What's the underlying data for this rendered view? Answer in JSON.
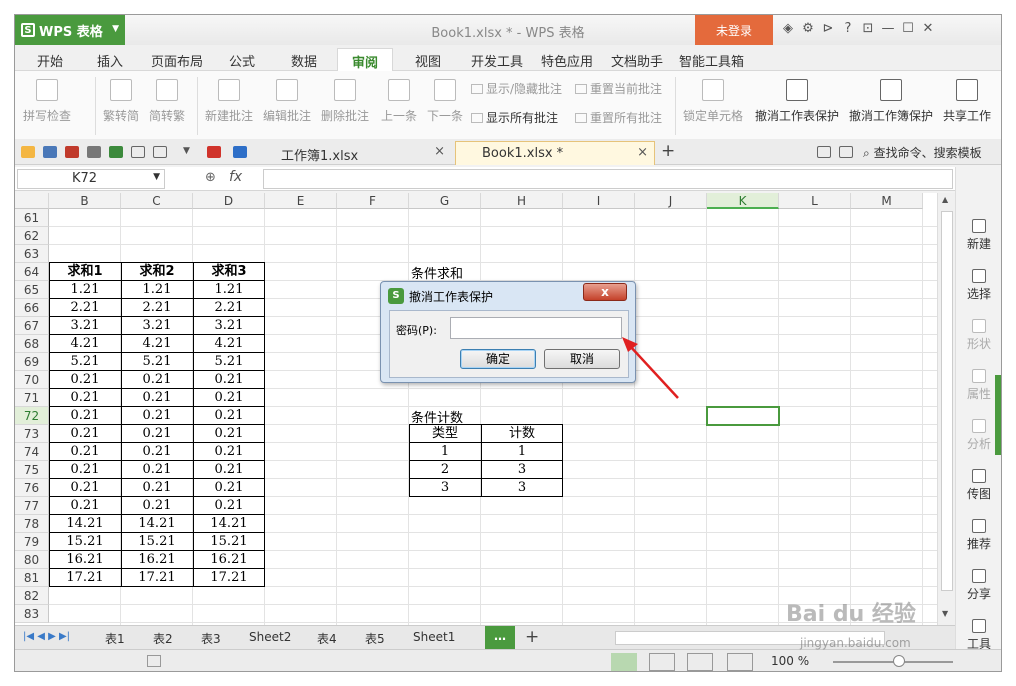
{
  "app": {
    "name": "WPS 表格",
    "doc_title": "Book1.xlsx * - WPS 表格",
    "login": "未登录"
  },
  "menu": [
    "开始",
    "插入",
    "页面布局",
    "公式",
    "数据",
    "审阅",
    "视图",
    "开发工具",
    "特色应用",
    "文档助手",
    "智能工具箱"
  ],
  "active_menu": "审阅",
  "ribbon": {
    "spell": "拼写检查",
    "trad2simp": "繁转简",
    "simp2trad": "简转繁",
    "new_comment": "新建批注",
    "edit_comment": "编辑批注",
    "del_comment": "删除批注",
    "prev": "上一条",
    "next": "下一条",
    "show_hide": "显示/隐藏批注",
    "reset_cur": "重置当前批注",
    "show_all": "显示所有批注",
    "reset_all": "重置所有批注",
    "lock_cell": "锁定单元格",
    "unprotect_sheet": "撤消工作表保护",
    "unprotect_book": "撤消工作簿保护",
    "share": "共享工作"
  },
  "file_tabs": [
    {
      "name": "工作簿1.xlsx",
      "close": "×"
    },
    {
      "name": "Book1.xlsx *",
      "close": "×"
    }
  ],
  "search_placeholder": "查找命令、搜索模板",
  "namebox": "K72",
  "fx": "fx",
  "columns": [
    "B",
    "C",
    "D",
    "E",
    "F",
    "G",
    "H",
    "I",
    "J",
    "K",
    "L",
    "M"
  ],
  "rows": [
    "61",
    "62",
    "63",
    "64",
    "65",
    "66",
    "67",
    "68",
    "69",
    "70",
    "71",
    "72",
    "73",
    "74",
    "75",
    "76",
    "77",
    "78",
    "79",
    "80",
    "81",
    "82",
    "83"
  ],
  "table1": {
    "headers": [
      "求和1",
      "求和2",
      "求和3"
    ],
    "values": [
      "1.21",
      "2.21",
      "3.21",
      "4.21",
      "5.21",
      "0.21",
      "0.21",
      "0.21",
      "0.21",
      "0.21",
      "0.21",
      "0.21",
      "0.21",
      "14.21",
      "15.21",
      "16.21",
      "17.21"
    ]
  },
  "labels": {
    "cond_sum": "条件求和",
    "cond_count": "条件计数"
  },
  "table2": {
    "headers": [
      "类型",
      "计数"
    ],
    "rows": [
      [
        "1",
        "1"
      ],
      [
        "2",
        "3"
      ],
      [
        "3",
        "3"
      ]
    ]
  },
  "dialog": {
    "title": "撤消工作表保护",
    "label": "密码(P):",
    "ok": "确定",
    "cancel": "取消",
    "close": "x"
  },
  "sheets": [
    "表1",
    "表2",
    "表3",
    "Sheet2",
    "表4",
    "表5",
    "Sheet1"
  ],
  "add_sheet": "…",
  "plus": "+",
  "side_panel": [
    {
      "label": "新建",
      "dim": false
    },
    {
      "label": "选择",
      "dim": false
    },
    {
      "label": "形状",
      "dim": true
    },
    {
      "label": "属性",
      "dim": true
    },
    {
      "label": "分析",
      "dim": true
    },
    {
      "label": "传图",
      "dim": false
    },
    {
      "label": "推荐",
      "dim": false
    },
    {
      "label": "分享",
      "dim": false
    },
    {
      "label": "工具",
      "dim": false
    }
  ],
  "zoom": "100 %",
  "watermark": "Bai du 经验",
  "watermark_url": "jingyan.baidu.com",
  "colors": {
    "accent": "#4a9a3e",
    "login": "#e46a3c",
    "arrow": "#e02020"
  }
}
